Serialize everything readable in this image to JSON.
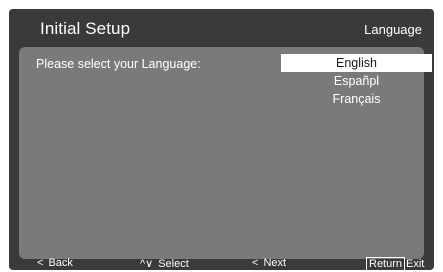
{
  "header": {
    "title": "Initial Setup",
    "page": "Language"
  },
  "panel": {
    "prompt": "Please select your Language:",
    "languages": [
      {
        "label": "English",
        "selected": true
      },
      {
        "label": "Españpl",
        "selected": false
      },
      {
        "label": "Français",
        "selected": false
      }
    ]
  },
  "footer": {
    "back_glyph": "<",
    "back_label": "Back",
    "select_glyph": "^∨",
    "select_label": "Select",
    "next_glyph": "<",
    "next_label": "Next",
    "return_key": "Return",
    "exit_label": "Exit"
  },
  "colors": {
    "frame": "#3a3a3a",
    "panel": "#7a7a7c",
    "selection": "#ffffff",
    "text": "#ffffff"
  },
  "icons": {
    "back": "left-chevron-icon",
    "select": "up-down-chevron-icon",
    "next": "left-chevron-icon"
  }
}
